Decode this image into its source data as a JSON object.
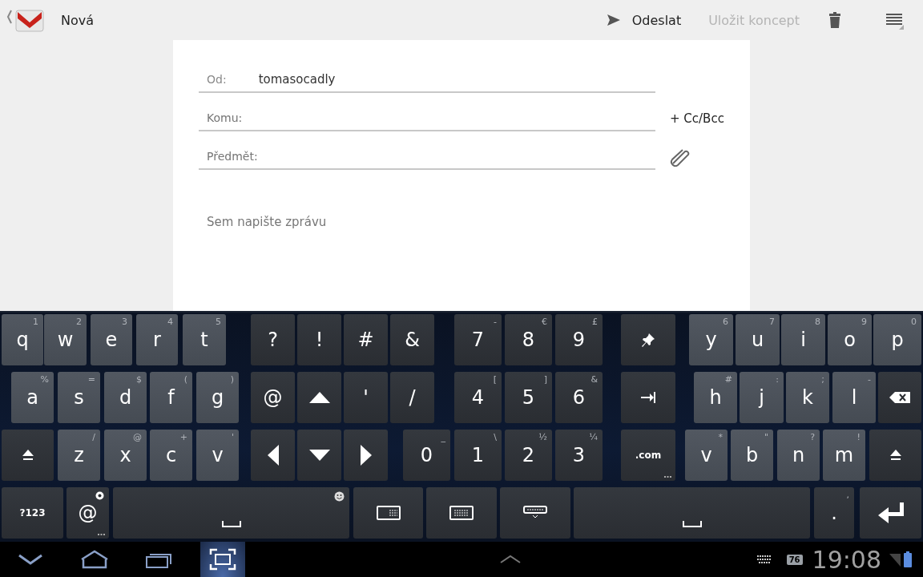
{
  "action_bar": {
    "title": "Nová",
    "send": {
      "label": "Odeslat"
    },
    "save_draft": {
      "label": "Uložit koncept",
      "disabled": true
    }
  },
  "compose": {
    "from": {
      "label": "Od:",
      "value": "tomasocadly"
    },
    "to": {
      "placeholder": "Komu:"
    },
    "cc_bcc": "+ Cc/Bcc",
    "subject": {
      "placeholder": "Předmět:"
    },
    "body": {
      "placeholder": "Sem napište zprávu"
    }
  },
  "keyboard": {
    "rows": [
      {
        "keys": [
          {
            "kind": "letter",
            "label": "q",
            "hint": "1"
          },
          {
            "kind": "letter",
            "label": "w",
            "hint": "2"
          },
          {
            "kind": "letter",
            "label": "e",
            "hint": "3"
          },
          {
            "kind": "letter",
            "label": "r",
            "hint": "4"
          },
          {
            "kind": "letter",
            "label": "t",
            "hint": "5"
          },
          {
            "kind": "symbol",
            "label": "?"
          },
          {
            "kind": "symbol",
            "label": "!"
          },
          {
            "kind": "symbol",
            "label": "#"
          },
          {
            "kind": "symbol",
            "label": "&"
          },
          {
            "kind": "symbol",
            "label": "7",
            "hint": "-"
          },
          {
            "kind": "symbol",
            "label": "8",
            "hint": "€"
          },
          {
            "kind": "symbol",
            "label": "9",
            "hint": "£"
          },
          {
            "kind": "pin"
          },
          {
            "kind": "letter",
            "label": "y",
            "hint": "6"
          },
          {
            "kind": "letter",
            "label": "u",
            "hint": "7"
          },
          {
            "kind": "letter",
            "label": "i",
            "hint": "8"
          },
          {
            "kind": "letter",
            "label": "o",
            "hint": "9"
          },
          {
            "kind": "letter",
            "label": "p",
            "hint": "0"
          }
        ]
      },
      {
        "keys": [
          {
            "kind": "letter",
            "label": "a",
            "hint": "%"
          },
          {
            "kind": "letter",
            "label": "s",
            "hint": "="
          },
          {
            "kind": "letter",
            "label": "d",
            "hint": "$"
          },
          {
            "kind": "letter",
            "label": "f",
            "hint": "("
          },
          {
            "kind": "letter",
            "label": "g",
            "hint": ")"
          },
          {
            "kind": "symbol",
            "label": "@"
          },
          {
            "kind": "arrow-up"
          },
          {
            "kind": "symbol",
            "label": "'"
          },
          {
            "kind": "symbol",
            "label": "/"
          },
          {
            "kind": "symbol",
            "label": "4",
            "hint": "["
          },
          {
            "kind": "symbol",
            "label": "5",
            "hint": "]"
          },
          {
            "kind": "symbol",
            "label": "6",
            "hint": "&"
          },
          {
            "kind": "tab"
          },
          {
            "kind": "letter",
            "label": "h",
            "hint": "#"
          },
          {
            "kind": "letter",
            "label": "j",
            "hint": ":"
          },
          {
            "kind": "letter",
            "label": "k",
            "hint": ";"
          },
          {
            "kind": "letter",
            "label": "l",
            "hint": "-"
          },
          {
            "kind": "backspace"
          }
        ]
      },
      {
        "keys": [
          {
            "kind": "shift"
          },
          {
            "kind": "letter",
            "label": "z",
            "hint": "/"
          },
          {
            "kind": "letter",
            "label": "x",
            "hint": "@"
          },
          {
            "kind": "letter",
            "label": "c",
            "hint": "+"
          },
          {
            "kind": "letter",
            "label": "v",
            "hint": "'"
          },
          {
            "kind": "arrow-left"
          },
          {
            "kind": "arrow-down"
          },
          {
            "kind": "arrow-right"
          },
          {
            "kind": "symbol",
            "label": "0",
            "hint": "_"
          },
          {
            "kind": "symbol",
            "label": "1",
            "hint": "\\"
          },
          {
            "kind": "symbol",
            "label": "2",
            "hint": "½"
          },
          {
            "kind": "symbol",
            "label": "3",
            "hint": "¼"
          },
          {
            "kind": "function",
            "label": ".com",
            "popup": true
          },
          {
            "kind": "letter",
            "label": "v",
            "hint": "*"
          },
          {
            "kind": "letter",
            "label": "b",
            "hint": "\""
          },
          {
            "kind": "letter",
            "label": "n",
            "hint": "?"
          },
          {
            "kind": "letter",
            "label": "m",
            "hint": "!"
          },
          {
            "kind": "shift"
          }
        ]
      },
      {
        "keys": [
          {
            "kind": "function",
            "label": "?123"
          },
          {
            "kind": "symbol",
            "label": "@",
            "popup": true,
            "settings_mark": true
          },
          {
            "kind": "space",
            "emoji_mark": true
          },
          {
            "kind": "keyboard"
          },
          {
            "kind": "keyboard-grid"
          },
          {
            "kind": "keyboard-hide"
          },
          {
            "kind": "space"
          },
          {
            "kind": "symbol",
            "label": ".",
            "hint": ","
          },
          {
            "kind": "enter"
          }
        ]
      }
    ]
  },
  "nav_bar": {
    "buttons": [
      {
        "kind": "back",
        "selected": false
      },
      {
        "kind": "home",
        "selected": false
      },
      {
        "kind": "recents",
        "selected": false
      },
      {
        "kind": "screenshot",
        "selected": true
      }
    ],
    "show_more": true
  },
  "status": {
    "notification": "76",
    "time": "19:08"
  }
}
